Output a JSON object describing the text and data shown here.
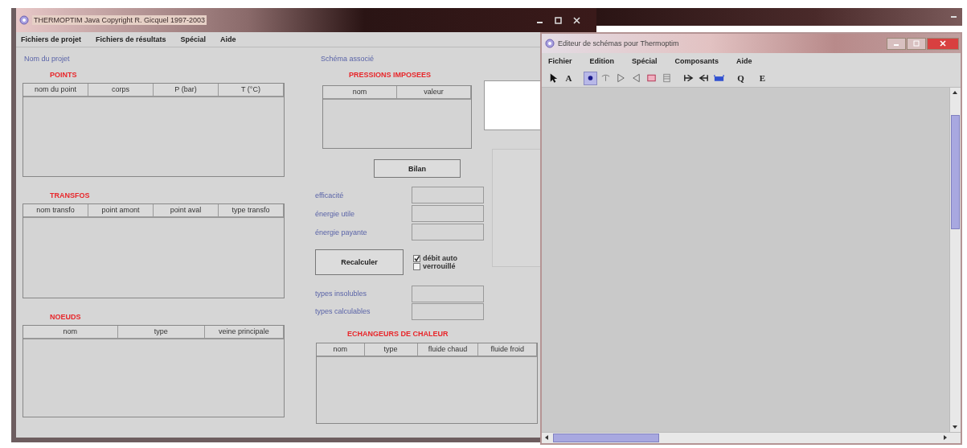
{
  "main_window": {
    "title": "THERMOPTIM Java Copyright R. Gicquel 1997-2003",
    "menu": [
      "Fichiers de projet",
      "Fichiers de résultats",
      "Spécial",
      "Aide"
    ],
    "project_label": "Nom du projet",
    "schema_label": "Schéma associé",
    "points": {
      "title": "POINTS",
      "columns": [
        "nom du point",
        "corps",
        "P (bar)",
        "T (°C)"
      ]
    },
    "transfos": {
      "title": "TRANSFOS",
      "columns": [
        "nom transfo",
        "point amont",
        "point aval",
        "type transfo"
      ]
    },
    "noeuds": {
      "title": "NOEUDS",
      "columns": [
        "nom",
        "type",
        "veine principale"
      ]
    },
    "pressions": {
      "title": "PRESSIONS IMPOSEES",
      "columns": [
        "nom",
        "valeur"
      ]
    },
    "bilan_button": "Bilan",
    "results": [
      {
        "label": "efficacité"
      },
      {
        "label": "énergie utile"
      },
      {
        "label": "énergie payante"
      }
    ],
    "recalc_button": "Recalculer",
    "options": [
      {
        "label": "débit auto",
        "checked": true
      },
      {
        "label": "verrouillé",
        "checked": false
      }
    ],
    "types": [
      {
        "label": "types insolubles"
      },
      {
        "label": "types calculables"
      }
    ],
    "echangeurs": {
      "title": "ECHANGEURS DE CHALEUR",
      "columns": [
        "nom",
        "type",
        "fluide chaud",
        "fluide froid"
      ]
    }
  },
  "editor_window": {
    "title": "Editeur de schémas pour Thermoptim",
    "menu": [
      "Fichier",
      "Edition",
      "Spécial",
      "Composants",
      "Aide"
    ],
    "tools": [
      {
        "kind": "arrow",
        "selected": false
      },
      {
        "kind": "letter",
        "label": "A",
        "selected": false
      },
      {
        "kind": "dot",
        "selected": true
      },
      {
        "kind": "mixer",
        "selected": false
      },
      {
        "kind": "right",
        "selected": false
      },
      {
        "kind": "left",
        "selected": false
      },
      {
        "kind": "chamber",
        "selected": false
      },
      {
        "kind": "exchanger",
        "selected": false
      },
      {
        "kind": "split",
        "selected": false
      },
      {
        "kind": "merge",
        "selected": false
      },
      {
        "kind": "tank",
        "selected": false
      },
      {
        "kind": "letter",
        "label": "Q",
        "selected": false
      },
      {
        "kind": "letter",
        "label": "E",
        "selected": false
      }
    ]
  }
}
